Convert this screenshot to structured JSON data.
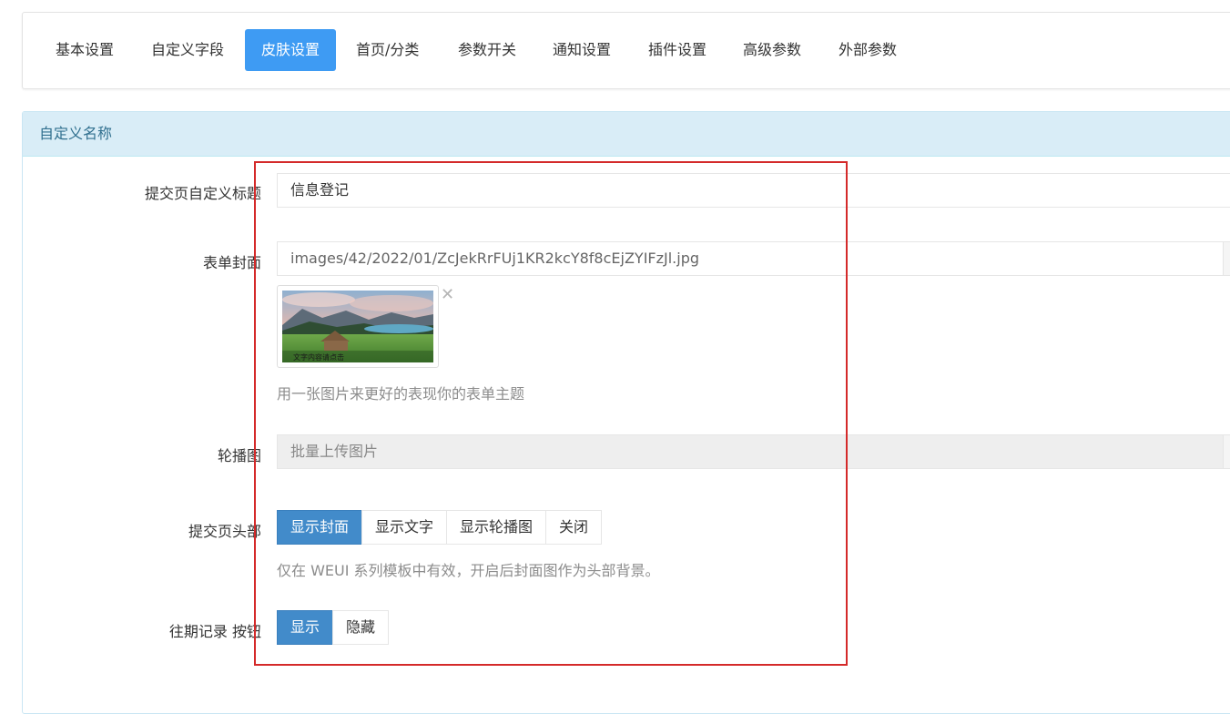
{
  "tabs": [
    {
      "label": "基本设置"
    },
    {
      "label": "自定义字段"
    },
    {
      "label": "皮肤设置",
      "active": true
    },
    {
      "label": "首页/分类"
    },
    {
      "label": "参数开关"
    },
    {
      "label": "通知设置"
    },
    {
      "label": "插件设置"
    },
    {
      "label": "高级参数"
    },
    {
      "label": "外部参数"
    }
  ],
  "panel": {
    "title": "自定义名称"
  },
  "form": {
    "submit_title": {
      "label": "提交页自定义标题",
      "value": "信息登记"
    },
    "cover": {
      "label": "表单封面",
      "value": "images/42/2022/01/ZcJekRrFUj1KR2kcY8f8cEjZYIFzJl.jpg",
      "thumb_caption": "文字内容请点击",
      "remove_glyph": "✕",
      "help": "用一张图片来更好的表现你的表单主题"
    },
    "carousel": {
      "label": "轮播图",
      "placeholder": "批量上传图片"
    },
    "header": {
      "label": "提交页头部",
      "options": [
        "显示封面",
        "显示文字",
        "显示轮播图",
        "关闭"
      ],
      "selected": "显示封面",
      "help": "仅在 WEUI 系列模板中有效，开启后封面图作为头部背景。"
    },
    "history_button": {
      "label": "往期记录 按钮",
      "options": [
        "显示",
        "隐藏"
      ],
      "selected": "显示"
    }
  },
  "colors": {
    "tab_active": "#3e9bf3",
    "panel_heading_bg": "#d9edf7",
    "panel_heading_text": "#31708f",
    "btn_active": "#428bca",
    "highlight": "#d42a2a"
  }
}
